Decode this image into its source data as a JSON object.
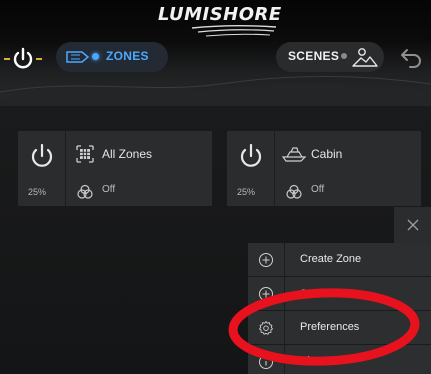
{
  "header": {
    "brand": "LUMISHORE",
    "zones_label": "ZONES",
    "scenes_label": "SCENES"
  },
  "zones": [
    {
      "name": "All Zones",
      "brightness": "25%",
      "scene": "Off",
      "icon": "grid-zones-icon"
    },
    {
      "name": "Cabin",
      "brightness": "25%",
      "scene": "Off",
      "icon": "boat-icon"
    }
  ],
  "menu": {
    "items": [
      {
        "label": "Create Zone",
        "icon": "plus-circle-icon"
      },
      {
        "label": "Save as Sc",
        "icon": "plus-circle-icon"
      },
      {
        "label": "Preferences",
        "icon": "gear-icon"
      },
      {
        "label": "About",
        "icon": "info-icon"
      }
    ]
  },
  "colors": {
    "accent_blue": "#4aa9ff",
    "power_yellow": "#d9b23a",
    "annotation_red": "#e8121e"
  }
}
